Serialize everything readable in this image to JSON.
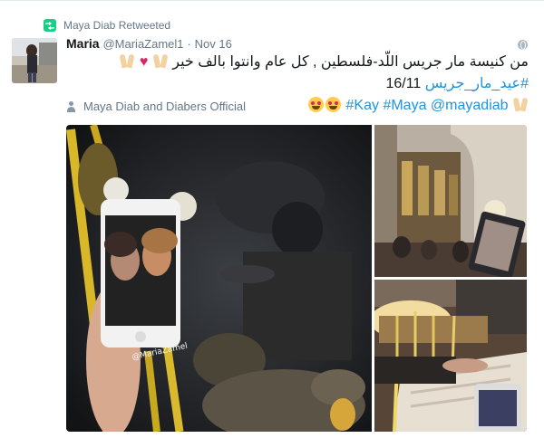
{
  "retweet": {
    "label": "Maya Diab Retweeted"
  },
  "tweet": {
    "author_name": "Maria",
    "handle": "@MariaZamel1",
    "separator": "·",
    "date": "Nov 16",
    "text_line1": "من كنيسة مار جريس اللّد-فلسطين , كل عام وانتوا بالف خير",
    "hashtag_eid": "#عيد_مار_جريس",
    "date_text": "16/11",
    "hashtag_kay": "#Kay",
    "hashtag_maya": "#Maya",
    "mention": "@mayadiab",
    "tagged": "Maya Diab and Diabers Official"
  },
  "media": {
    "watermark": "@MariaZamel"
  },
  "icons": [
    "retweet-icon",
    "globe-icon",
    "person-icon",
    "heart-emoji",
    "folded-hands-emoji",
    "heart-eyes-emoji"
  ],
  "colors": {
    "accent": "#1b95e0",
    "retweet": "#19cf86",
    "muted": "#657786",
    "heart": "#e0245e"
  }
}
